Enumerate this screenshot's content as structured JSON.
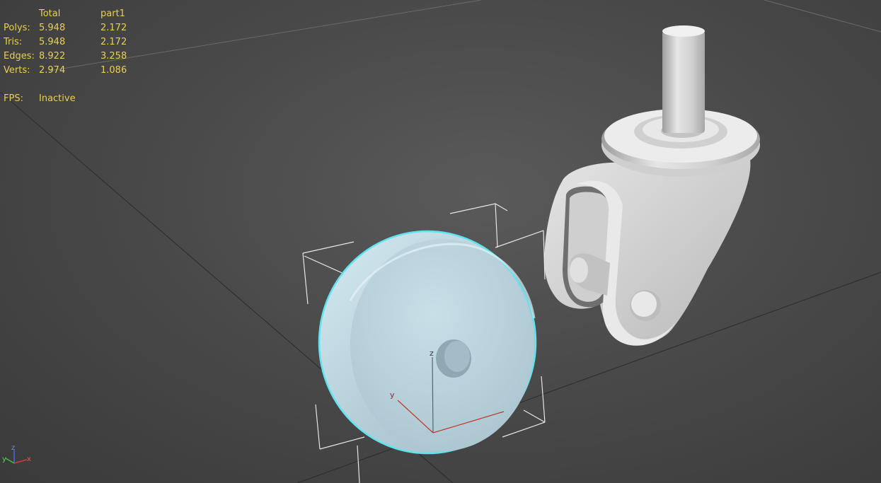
{
  "stats": {
    "header": {
      "total": "Total",
      "object": "part1"
    },
    "rows": [
      {
        "label": "Polys:",
        "total": "5.948",
        "object": "2.172"
      },
      {
        "label": "Tris:",
        "total": "5.948",
        "object": "2.172"
      },
      {
        "label": "Edges:",
        "total": "8.922",
        "object": "3.258"
      },
      {
        "label": "Verts:",
        "total": "2.974",
        "object": "1.086"
      }
    ],
    "fps": {
      "label": "FPS:",
      "value": "Inactive"
    }
  },
  "gizmo": {
    "z": "z",
    "y": "y"
  },
  "world_axis": {
    "z": "z",
    "y": "y",
    "x": "x"
  },
  "colors": {
    "background": "#4a4a4a",
    "stats_text": "#e8cf55",
    "selection_outline": "#5fe3ee",
    "selected_object": "#b4ccd6",
    "object_gray": "#d4d4d4"
  }
}
